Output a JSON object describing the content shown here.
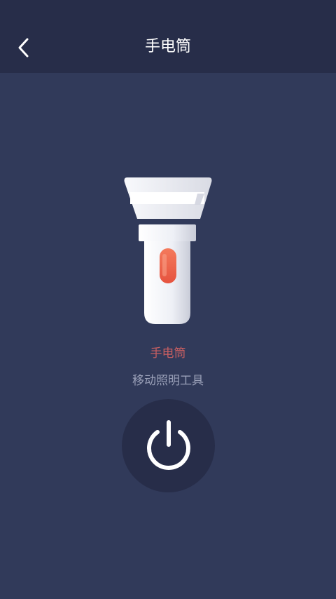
{
  "header": {
    "title": "手电筒",
    "back_icon": "chevron-left-icon"
  },
  "hero": {
    "name": "手电筒",
    "description": "移动照明工具",
    "icon": "flashlight-icon"
  },
  "power": {
    "icon": "power-icon"
  },
  "colors": {
    "background": "#313a5a",
    "header_background": "#272d49",
    "name_color": "#c95f61",
    "description_color": "#9aa0b8",
    "switch_indicator": "#f26a4f"
  }
}
